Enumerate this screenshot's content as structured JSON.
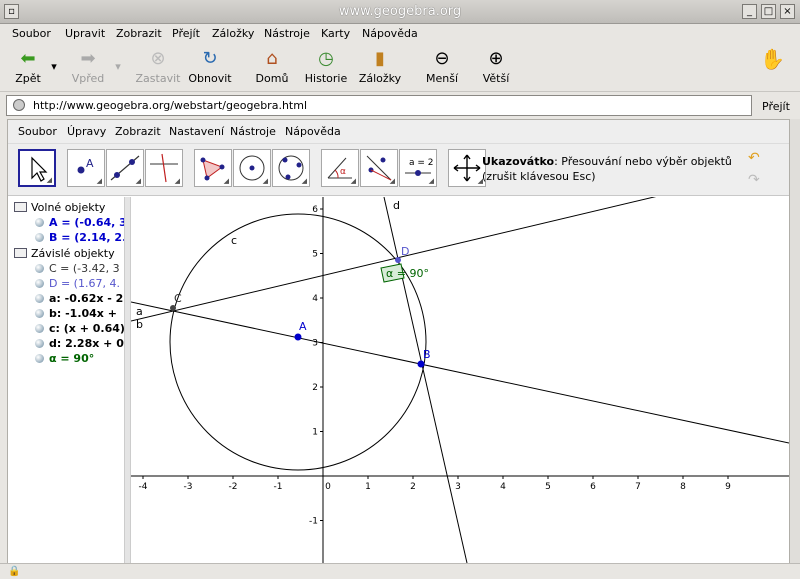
{
  "window": {
    "title": "www.geogebra.org"
  },
  "browser_menu": [
    "Soubor",
    "Upravit",
    "Zobrazit",
    "Přejít",
    "Záložky",
    "Nástroje",
    "Karty",
    "Nápověda"
  ],
  "nav": {
    "back": "Zpět",
    "forward": "Vpřed",
    "stop": "Zastavit",
    "reload": "Obnovit",
    "home": "Domů",
    "history": "Historie",
    "bookmarks": "Záložky",
    "smaller": "Menší",
    "larger": "Větší"
  },
  "url": {
    "value": "http://www.geogebra.org/webstart/geogebra.html",
    "go_label": "Přejít"
  },
  "app_menu": [
    "Soubor",
    "Úpravy",
    "Zobrazit",
    "Nastavení",
    "Nástroje",
    "Nápověda"
  ],
  "tool_description": {
    "name": "Ukazovátko",
    "text": ": Přesouvání nebo výběr objektů (zrušit klávesou Esc)"
  },
  "algebra": {
    "free_header": "Volné objekty",
    "free": [
      {
        "text": "A = (-0.64, 3",
        "color": "#0000cc"
      },
      {
        "text": "B = (2.14, 2.",
        "color": "#0000cc"
      }
    ],
    "dependent_header": "Závislé objekty",
    "dependent": [
      {
        "text": "C = (-3.42, 3",
        "color": "#333333"
      },
      {
        "text": "D = (1.67, 4.",
        "color": "#5555cc"
      },
      {
        "text": "a: -0.62x - 2",
        "color": "#000000"
      },
      {
        "text": "b: -1.04x +",
        "color": "#000000"
      },
      {
        "text": "c: (x + 0.64)²",
        "color": "#000000"
      },
      {
        "text": "d: 2.28x + 0.",
        "color": "#000000"
      },
      {
        "text": "α = 90°",
        "color": "#006400"
      }
    ]
  },
  "graph": {
    "x_ticks": [
      "-4",
      "-3",
      "-2",
      "-1",
      "0",
      "1",
      "2",
      "3",
      "4",
      "5",
      "6",
      "7",
      "8",
      "9"
    ],
    "y_ticks": [
      "-1",
      "1",
      "2",
      "3",
      "4",
      "5",
      "6"
    ],
    "labels": {
      "A": "A",
      "B": "B",
      "C": "C",
      "D": "D",
      "a": "a",
      "b": "b",
      "c": "c",
      "d": "d",
      "angle": "α = 90°"
    },
    "points": {
      "A": [
        -0.64,
        3.12
      ],
      "B": [
        2.14,
        2.55
      ],
      "C": [
        -3.42,
        3.79
      ],
      "D": [
        1.67,
        4.83
      ]
    },
    "circle": {
      "center": [
        -0.64,
        3.12
      ],
      "radius": 2.84
    }
  }
}
